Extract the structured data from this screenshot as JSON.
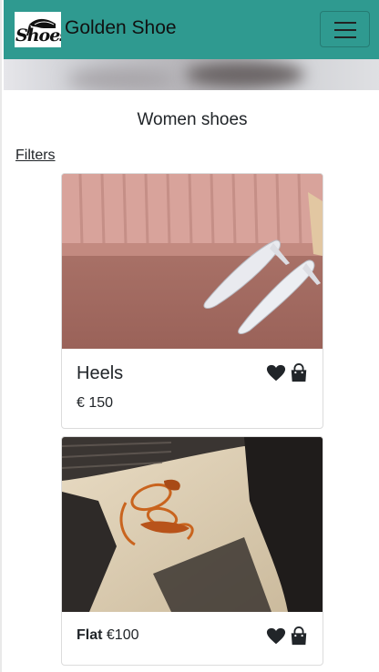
{
  "navbar": {
    "brand": "Golden Shoe",
    "logo_text": "Shoes",
    "toggler_icon": "hamburger-icon"
  },
  "page": {
    "title": "Women shoes",
    "filters_label": "Filters"
  },
  "products": [
    {
      "name": "Heels",
      "price": "€ 150",
      "actions": [
        "heart-icon",
        "shopping-bag-icon"
      ]
    },
    {
      "name": "Flat",
      "price": "€100",
      "actions": [
        "heart-icon",
        "shopping-bag-icon"
      ]
    }
  ],
  "colors": {
    "navbar": "#2f9a90",
    "text": "#212529"
  }
}
